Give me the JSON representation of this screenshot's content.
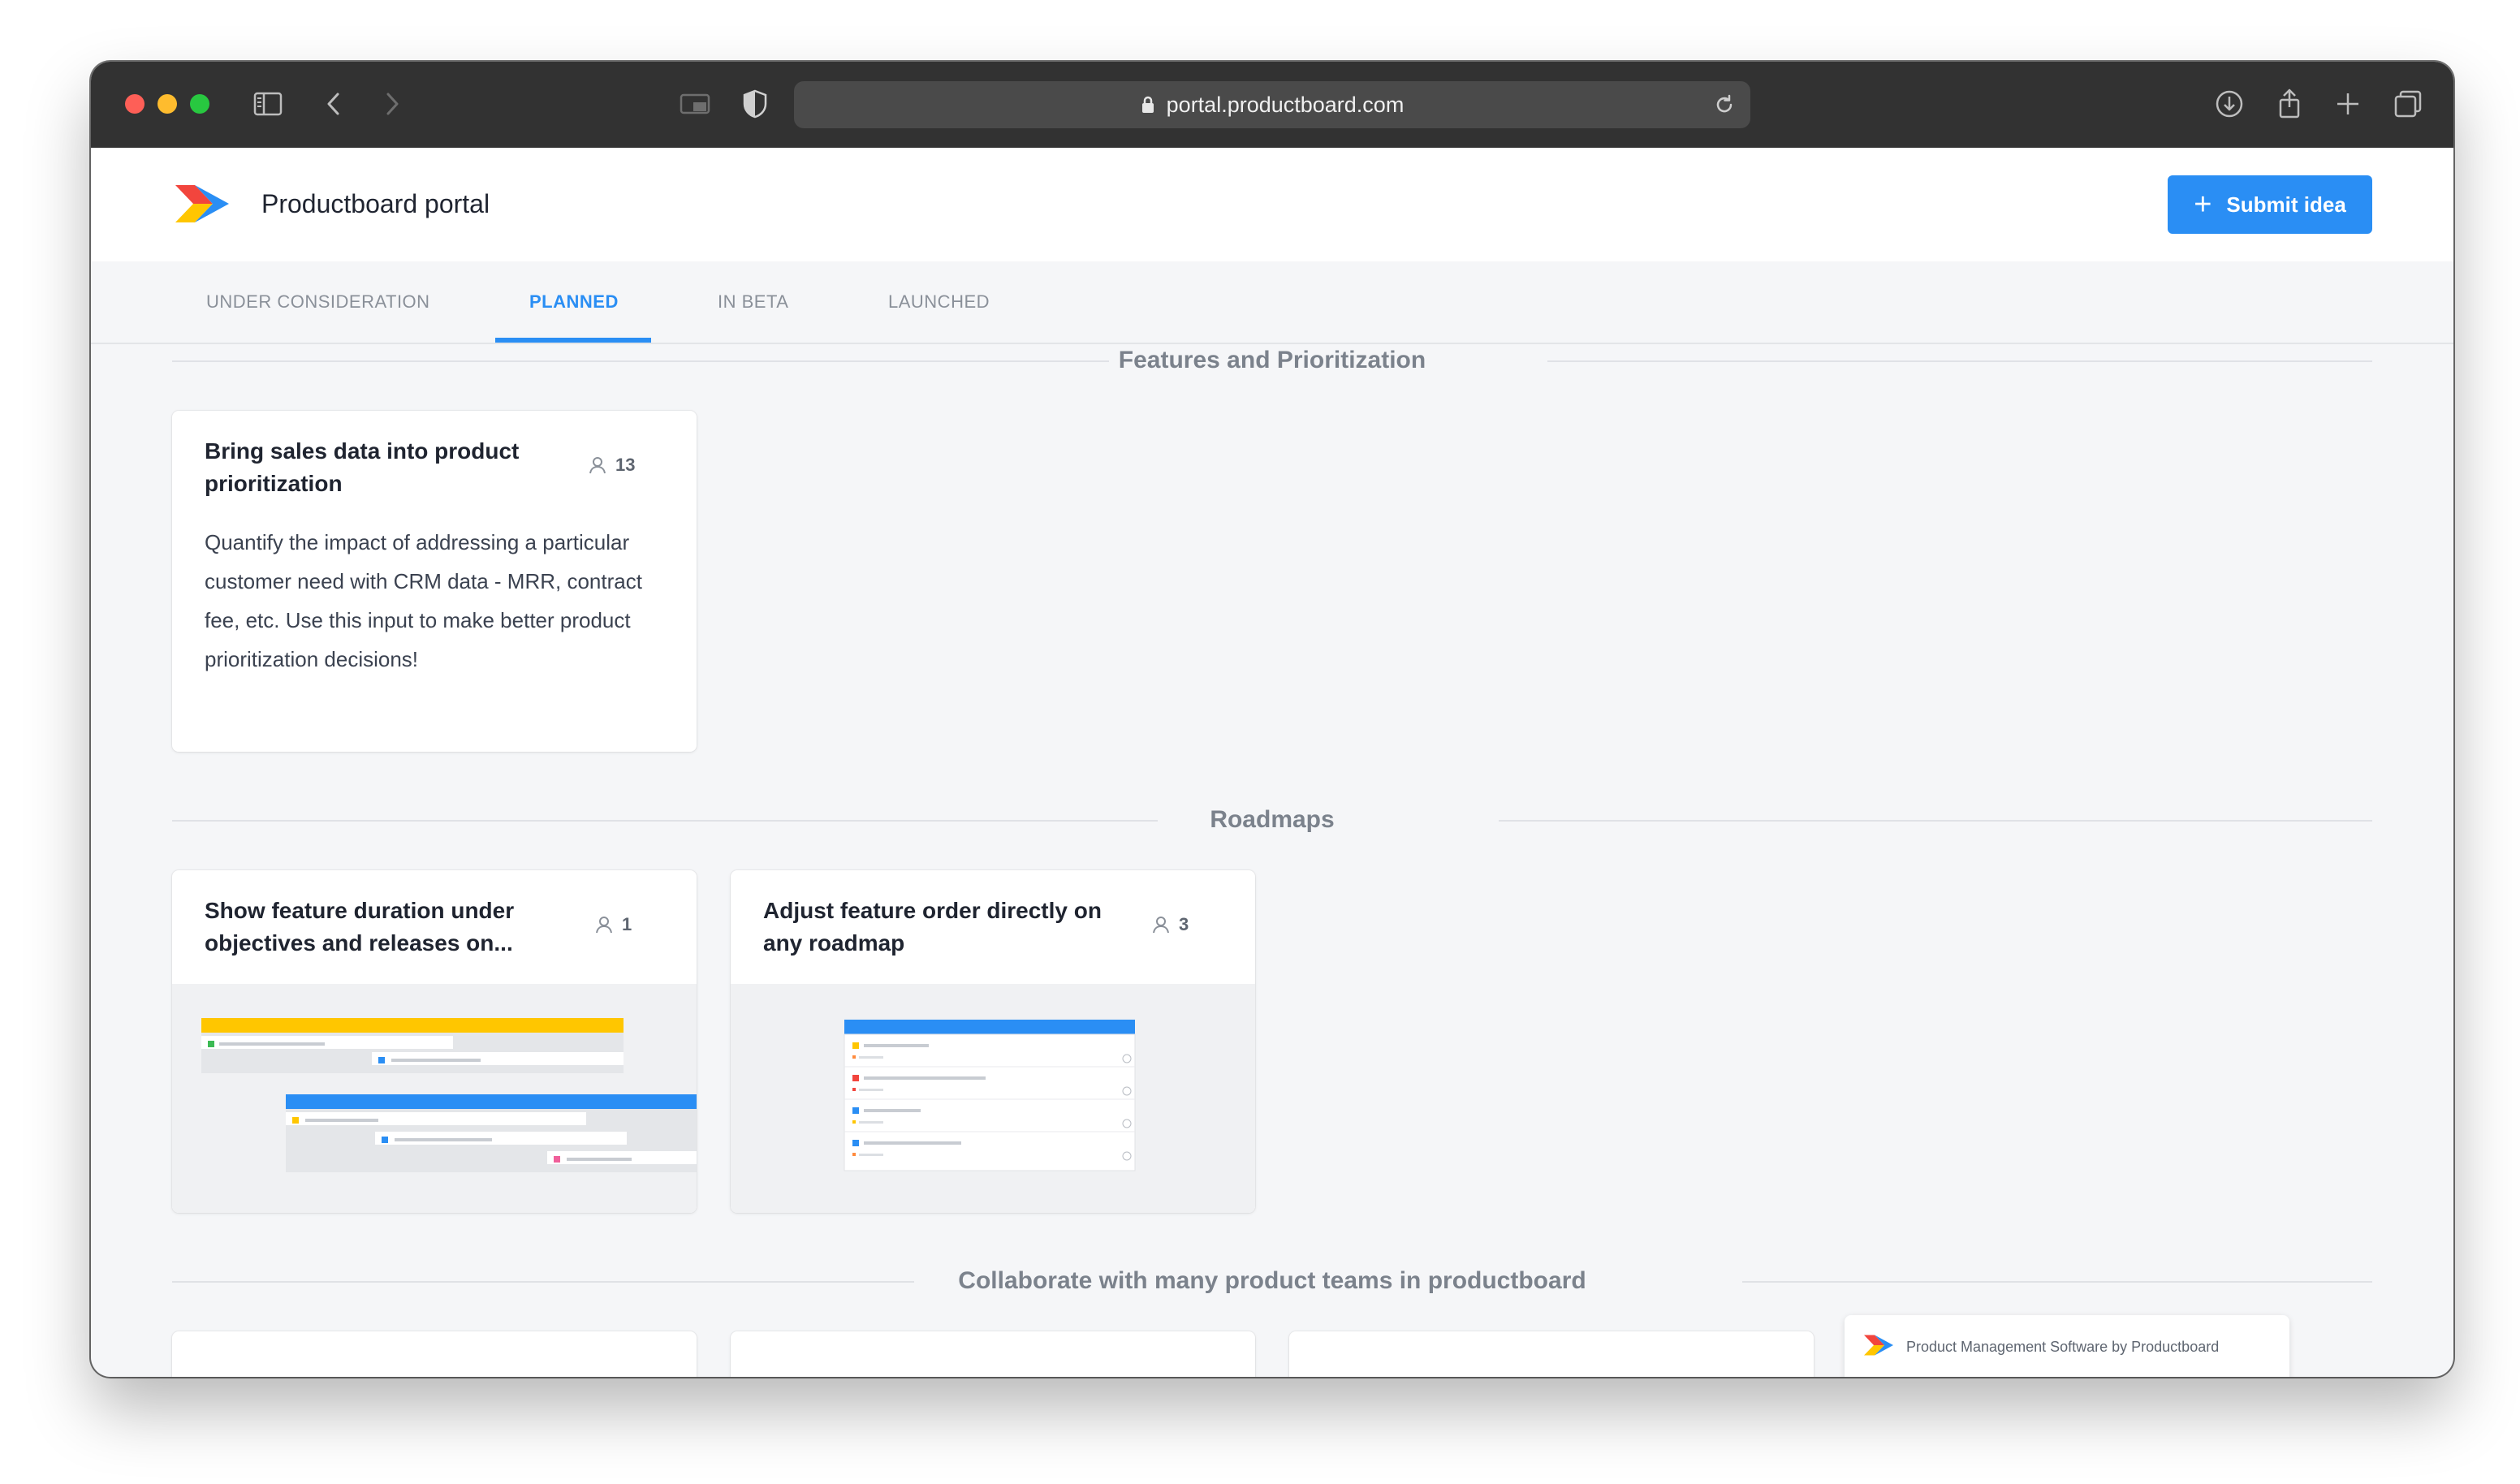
{
  "browser": {
    "url": "portal.productboard.com"
  },
  "header": {
    "title": "Productboard portal",
    "submit_label": "Submit idea"
  },
  "tabs": [
    {
      "label": "UNDER CONSIDERATION"
    },
    {
      "label": "PLANNED",
      "active": true
    },
    {
      "label": "IN BETA"
    },
    {
      "label": "LAUNCHED"
    }
  ],
  "sections": [
    {
      "title": "Features and Prioritization",
      "cards": [
        {
          "title": "Bring sales data into product prioritization",
          "votes": "13",
          "description": "Quantify the impact of addressing a particular customer need with CRM data - MRR, contract fee, etc. Use this input to make better product prioritization decisions!"
        }
      ]
    },
    {
      "title": "Roadmaps",
      "cards": [
        {
          "title": "Show feature duration under objectives and releases on...",
          "votes": "1",
          "image": "timeline-roadmap-preview"
        },
        {
          "title": "Adjust feature order directly on any roadmap",
          "votes": "3",
          "image": "list-roadmap-preview"
        }
      ]
    },
    {
      "title": "Collaborate with many product teams in productboard"
    }
  ],
  "footer_badge": {
    "label": "Product Management Software by Productboard"
  },
  "colors": {
    "accent": "#2a8ef4",
    "logo_red": "#f2453d",
    "logo_yellow": "#ffc600",
    "logo_blue": "#2a8ef4"
  }
}
